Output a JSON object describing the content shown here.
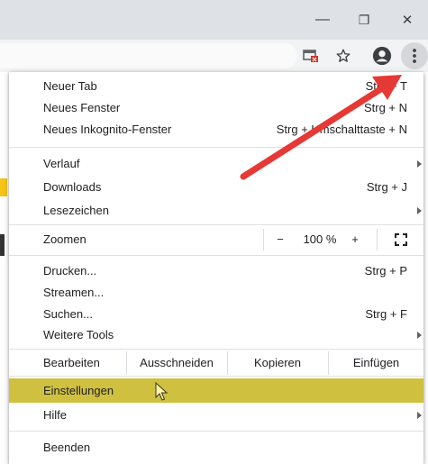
{
  "window": {
    "minimize_glyph": "—",
    "restore_glyph": "❐",
    "close_glyph": "✕"
  },
  "toolbar": {
    "icons": [
      "cast-badge-icon",
      "bookmark-star-icon",
      "profile-avatar-icon",
      "menu-kebab-icon"
    ]
  },
  "menu": {
    "items": [
      {
        "label": "Neuer Tab",
        "shortcut": "Strg + T"
      },
      {
        "label": "Neues Fenster",
        "shortcut": "Strg + N"
      },
      {
        "label": "Neues Inkognito-Fenster",
        "shortcut": "Strg + Umschalttaste + N"
      },
      {
        "label": "Verlauf",
        "shortcut": ""
      },
      {
        "label": "Downloads",
        "shortcut": "Strg + J"
      },
      {
        "label": "Lesezeichen",
        "shortcut": ""
      },
      {
        "label": "Drucken...",
        "shortcut": "Strg + P"
      },
      {
        "label": "Streamen...",
        "shortcut": ""
      },
      {
        "label": "Suchen...",
        "shortcut": "Strg + F"
      },
      {
        "label": "Weitere Tools",
        "shortcut": ""
      },
      {
        "label": "Einstellungen",
        "shortcut": ""
      },
      {
        "label": "Hilfe",
        "shortcut": ""
      },
      {
        "label": "Beenden",
        "shortcut": ""
      }
    ],
    "zoom": {
      "label": "Zoomen",
      "minus": "−",
      "value": "100 %",
      "plus": "+"
    },
    "edit": {
      "label": "Bearbeiten",
      "cut": "Ausschneiden",
      "copy": "Kopieren",
      "paste": "Einfügen"
    }
  },
  "colors": {
    "highlight": "#cfc13f",
    "annotation_arrow": "#e53935",
    "titlebar": "#dee1e6",
    "toolbar": "#f1f3f4"
  }
}
